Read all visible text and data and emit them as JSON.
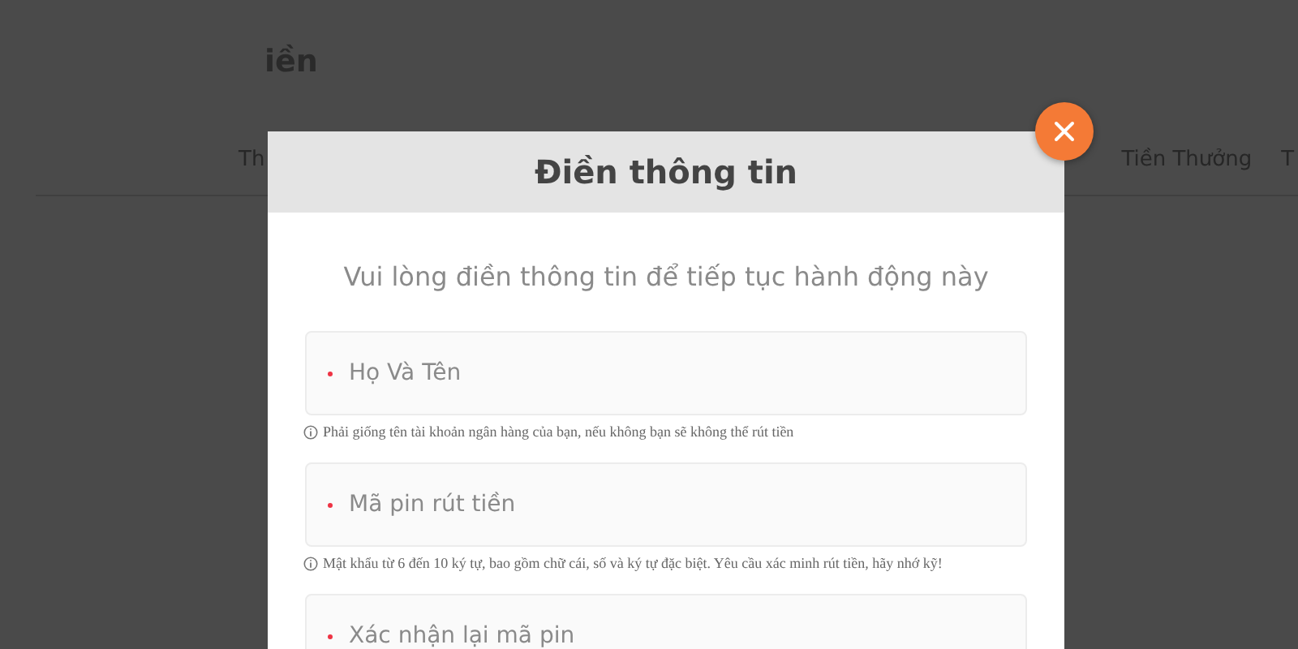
{
  "page": {
    "title": "iền",
    "nav": [
      "Th",
      "Tiền Thưởng",
      "T"
    ]
  },
  "dialog": {
    "title": "Điền thông tin",
    "subtitle": "Vui lòng điền thông tin để tiếp tục hành động này",
    "fields": [
      {
        "placeholder": "Họ Và Tên",
        "required": true,
        "hint": "Phải giống tên tài khoản ngân hàng của bạn, nếu không bạn sẽ không thể rút tiền"
      },
      {
        "placeholder": "Mã pin rút tiền",
        "required": true,
        "hint": "Mật khẩu từ 6 đến 10 ký tự, bao gồm chữ cái, số và ký tự đặc biệt. Yêu cầu xác minh rút tiền, hãy nhớ kỹ!"
      },
      {
        "placeholder": "Xác nhận lại mã pin",
        "required": true
      }
    ]
  }
}
